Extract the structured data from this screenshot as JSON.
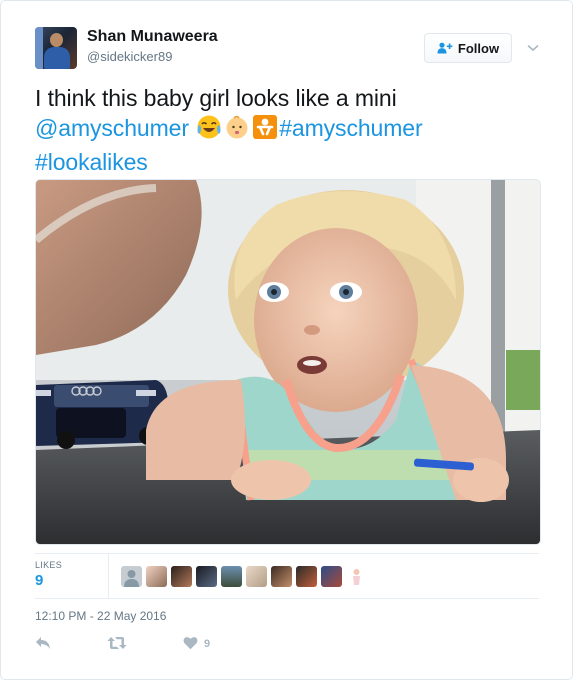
{
  "author": {
    "name": "Shan Munaweera",
    "handle": "@sidekicker89",
    "avatar_icon": "user-avatar"
  },
  "follow_button": {
    "label": "Follow",
    "icon": "add-person-icon"
  },
  "tweet": {
    "text_plain": "I think this baby girl looks like a mini",
    "mention": "@amyschumer",
    "hashtag1": "#amyschumer",
    "hashtag2": "#lookalikes",
    "emojis": [
      "face-with-tears-of-joy",
      "baby",
      "baby-symbol"
    ]
  },
  "media": {
    "kind": "photo",
    "subject": "baby",
    "car_logo": "audi"
  },
  "stats": {
    "likes_label": "LIKES",
    "likes_count": "9",
    "likers_count": 10
  },
  "timestamp": "12:10 PM - 22 May 2016",
  "actions": {
    "reply_icon": "reply-icon",
    "retweet_icon": "retweet-icon",
    "like_icon": "heart-icon",
    "like_count": "9"
  },
  "colors": {
    "link": "#1b95e0",
    "muted": "#657786",
    "icon": "#aab8c2",
    "text": "#14171a"
  }
}
